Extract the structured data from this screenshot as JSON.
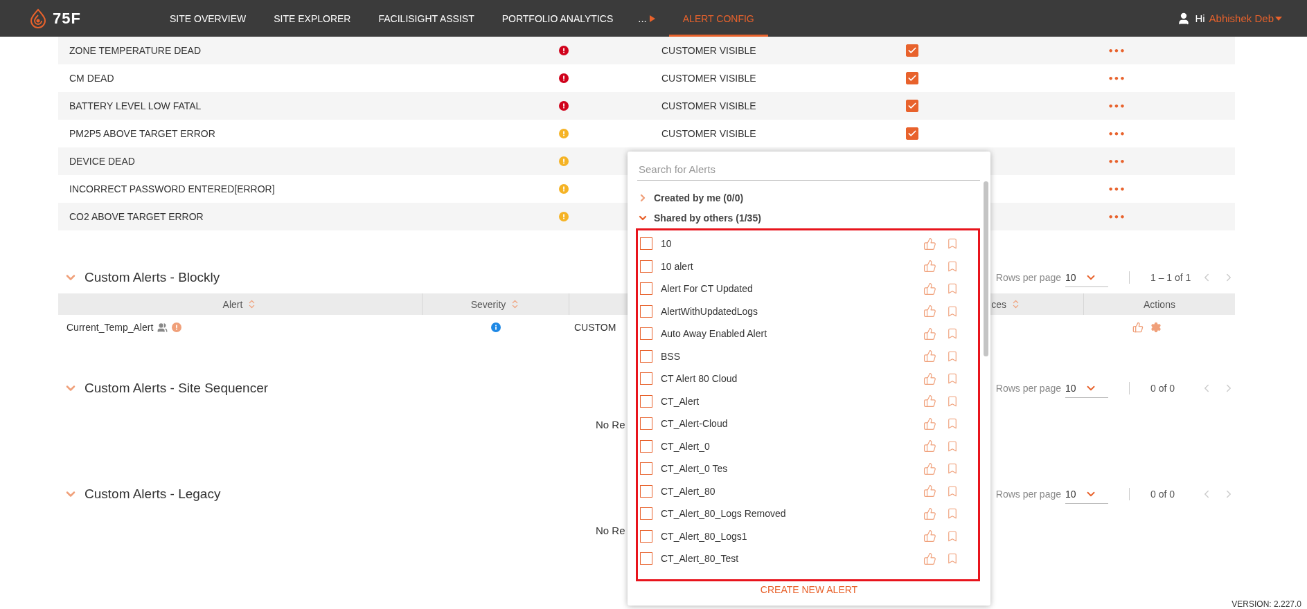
{
  "header": {
    "logo_text": "75F",
    "nav": [
      {
        "label": "SITE OVERVIEW",
        "selected": false
      },
      {
        "label": "SITE EXPLORER",
        "selected": false
      },
      {
        "label": "FACILISIGHT ASSIST",
        "selected": false
      },
      {
        "label": "PORTFOLIO ANALYTICS",
        "selected": false
      },
      {
        "label": "...",
        "selected": false,
        "kind": "more"
      },
      {
        "label": "ALERT CONFIG",
        "selected": true
      }
    ],
    "greeting": "Hi",
    "user_name": "Abhishek Deb"
  },
  "alerts_table": {
    "rows": [
      {
        "name": "ZONE TEMPERATURE DEAD",
        "severity": {
          "kind": "exclamation",
          "color": "#d0021b"
        },
        "visibility": "CUSTOMER VISIBLE",
        "checked": true,
        "more": "•••"
      },
      {
        "name": "CM DEAD",
        "severity": {
          "kind": "exclamation",
          "color": "#d0021b"
        },
        "visibility": "CUSTOMER VISIBLE",
        "checked": true,
        "more": "•••"
      },
      {
        "name": "BATTERY LEVEL LOW FATAL",
        "severity": {
          "kind": "exclamation",
          "color": "#d0021b"
        },
        "visibility": "CUSTOMER VISIBLE",
        "checked": true,
        "more": "•••"
      },
      {
        "name": "PM2P5 ABOVE TARGET ERROR",
        "severity": {
          "kind": "exclamation",
          "color": "#f5b325"
        },
        "visibility": "CUSTOMER VISIBLE",
        "checked": true,
        "more": "•••"
      },
      {
        "name": "DEVICE DEAD",
        "severity": {
          "kind": "exclamation",
          "color": "#f5b325"
        },
        "more": "•••"
      },
      {
        "name": "INCORRECT PASSWORD ENTERED[ERROR]",
        "severity": {
          "kind": "exclamation",
          "color": "#f5b325"
        },
        "more": "•••"
      },
      {
        "name": "CO2 ABOVE TARGET ERROR",
        "severity": {
          "kind": "exclamation",
          "color": "#f5b325"
        },
        "more": "•••"
      }
    ]
  },
  "sections": [
    {
      "title": "Custom Alerts - Blockly",
      "expanded": true,
      "rows_per_page_label": "Rows per page",
      "rows_per_page": "10",
      "range": "1 – 1 of 1",
      "columns": [
        "Alert",
        "Severity",
        "",
        "ces",
        "Actions"
      ],
      "rows": [
        {
          "alert": "Current_Temp_Alert",
          "shared": true,
          "severity": {
            "kind": "info",
            "color": "#1e88e5"
          },
          "visibility": "CUSTOM"
        }
      ]
    },
    {
      "title": "Custom Alerts - Site Sequencer",
      "expanded": true,
      "rows_per_page_label": "Rows per page",
      "rows_per_page": "10",
      "range": "0 of 0",
      "empty_text": "No Re"
    },
    {
      "title": "Custom Alerts - Legacy",
      "expanded": true,
      "rows_per_page_label": "Rows per page",
      "rows_per_page": "10",
      "range": "0 of 0",
      "empty_text": "No Re"
    }
  ],
  "alert_picker": {
    "search": {
      "placeholder": "Search for Alerts"
    },
    "groups": [
      {
        "label": "Created by me (0/0)",
        "expanded": false
      },
      {
        "label": "Shared by others (1/35)",
        "expanded": true
      }
    ],
    "items": [
      {
        "label": "10",
        "checked": false
      },
      {
        "label": "10 alert",
        "checked": false
      },
      {
        "label": "Alert For CT Updated",
        "checked": false
      },
      {
        "label": "AlertWithUpdatedLogs",
        "checked": false
      },
      {
        "label": "Auto Away Enabled Alert",
        "checked": false
      },
      {
        "label": "BSS",
        "checked": false
      },
      {
        "label": "CT Alert 80 Cloud",
        "checked": false
      },
      {
        "label": "CT_Alert",
        "checked": false
      },
      {
        "label": "CT_Alert-Cloud",
        "checked": false
      },
      {
        "label": "CT_Alert_0",
        "checked": false
      },
      {
        "label": "CT_Alert_0 Tes",
        "checked": false
      },
      {
        "label": "CT_Alert_80",
        "checked": false
      },
      {
        "label": "CT_Alert_80_Logs Removed",
        "checked": false
      },
      {
        "label": "CT_Alert_80_Logs1",
        "checked": false
      },
      {
        "label": "CT_Alert_80_Test",
        "checked": false
      }
    ],
    "create_label": "CREATE NEW ALERT"
  },
  "version": "VERSION: 2.227.0"
}
